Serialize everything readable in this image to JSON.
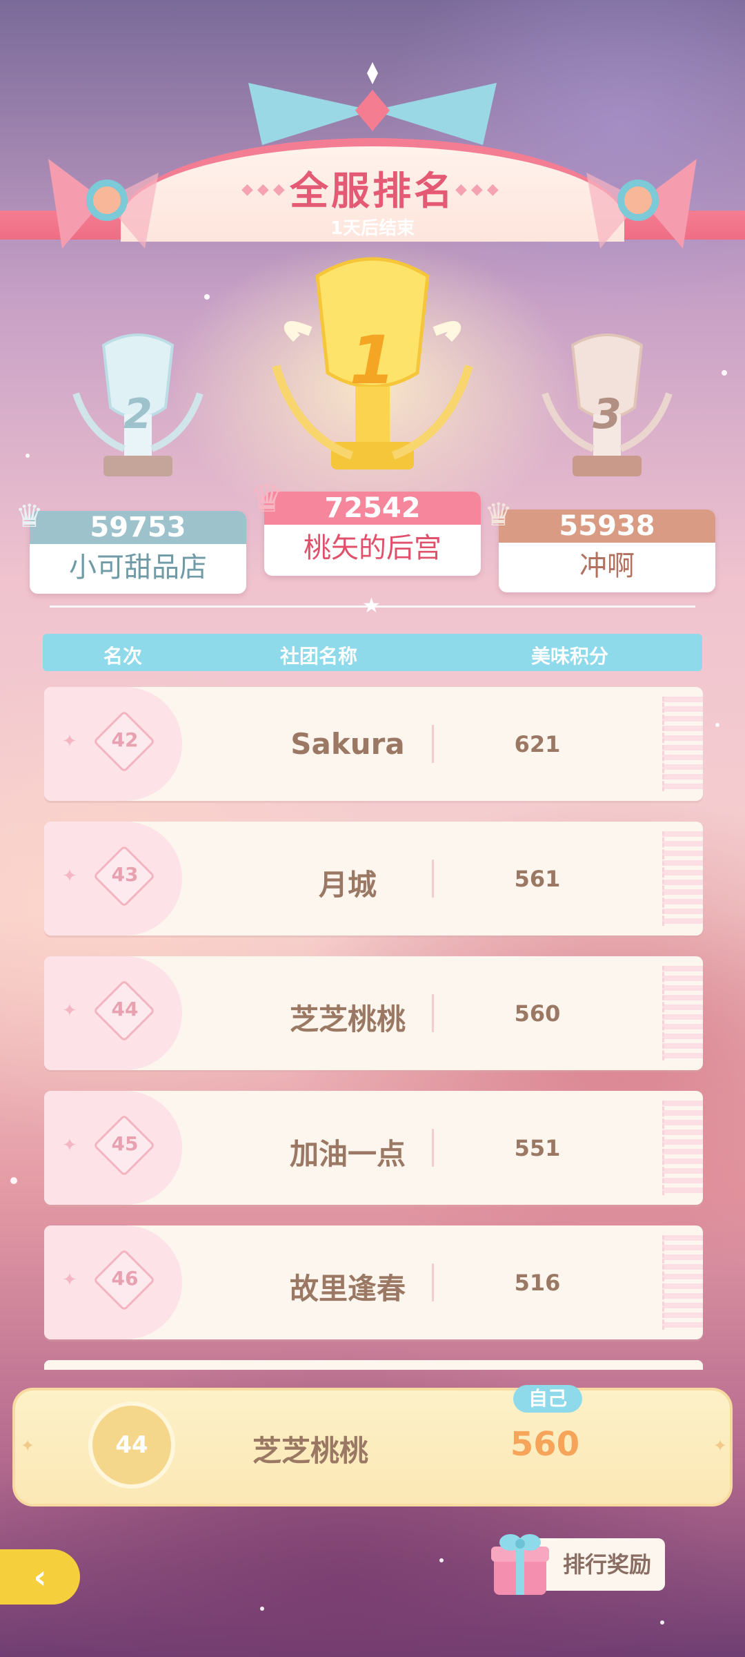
{
  "header": {
    "title": "全服排名",
    "subtitle": "1天后结束"
  },
  "podium": [
    {
      "rank": "1",
      "score": "72542",
      "name": "桃矢的后宫"
    },
    {
      "rank": "2",
      "score": "59753",
      "name": "小可甜品店"
    },
    {
      "rank": "3",
      "score": "55938",
      "name": "冲啊"
    }
  ],
  "table": {
    "col_rank": "名次",
    "col_name": "社团名称",
    "col_score": "美味积分",
    "rows": [
      {
        "rank": "42",
        "name": "Sakura",
        "score": "621"
      },
      {
        "rank": "43",
        "name": "月城",
        "score": "561"
      },
      {
        "rank": "44",
        "name": "芝芝桃桃",
        "score": "560"
      },
      {
        "rank": "45",
        "name": "加油一点",
        "score": "551"
      },
      {
        "rank": "46",
        "name": "故里逢春",
        "score": "516"
      }
    ]
  },
  "self": {
    "tag": "自己",
    "rank": "44",
    "name": "芝芝桃桃",
    "score": "560"
  },
  "footer": {
    "reward_label": "排行奖励"
  },
  "colors": {
    "title": "#e45a75",
    "gold": "#f6cf3c",
    "silver": "#9ec2cb",
    "bronze": "#d99b84",
    "accent": "#8ed9ea"
  }
}
